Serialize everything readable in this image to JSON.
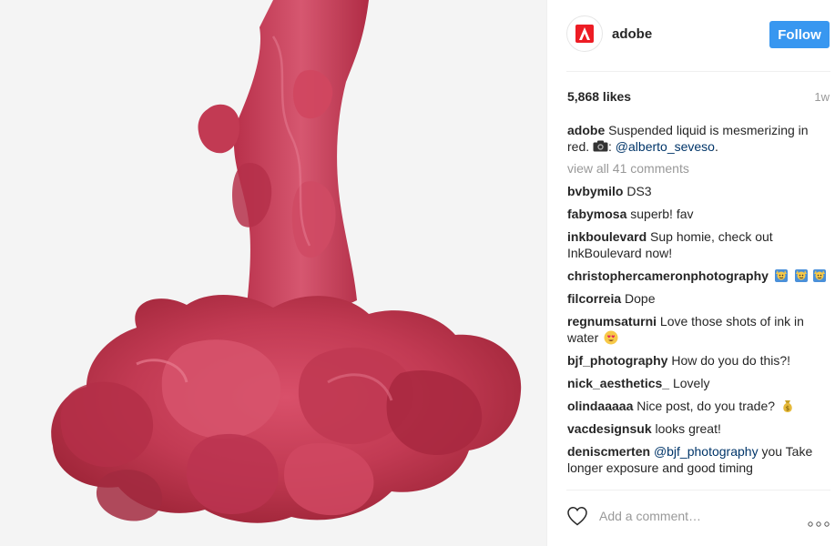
{
  "post": {
    "username": "adobe",
    "follow_label": "Follow",
    "likes": "5,868 likes",
    "time_ago": "1w",
    "caption": {
      "username": "adobe",
      "text": "Suspended liquid is mesmerizing in red. ",
      "separator": ": ",
      "mention": "@alberto_seveso",
      "end": "."
    },
    "view_all": "view all 41 comments",
    "comments": [
      {
        "user": "bvbymilo",
        "text": "DS3"
      },
      {
        "user": "fabymosa",
        "text": "superb! fav"
      },
      {
        "user": "inkboulevard",
        "text": "Sup homie, check out InkBoulevard now!"
      },
      {
        "user": "christophercameronphotography",
        "text": ""
      },
      {
        "user": "filcorreia",
        "text": "Dope"
      },
      {
        "user": "regnumsaturni",
        "text": "Love those shots of ink in water"
      },
      {
        "user": "bjf_photography",
        "text": "How do you do this?!"
      },
      {
        "user": "nick_aesthetics_",
        "text": "Lovely"
      },
      {
        "user": "olindaaaaa",
        "text": "Nice post, do you trade?"
      },
      {
        "user": "vacdesignsuk",
        "text": "looks great!"
      },
      {
        "user": "deniscmerten",
        "mention": "@bjf_photography",
        "text": "you Take longer exposure and good timing"
      }
    ],
    "add_comment_placeholder": "Add a comment…"
  },
  "icons": {
    "logo": "adobe-logo-icon",
    "camera": "camera-emoji-icon",
    "heart": "heart-icon",
    "more": "more-options-icon"
  },
  "colors": {
    "accent": "#3897f0",
    "ink": "#c23a53",
    "mention": "#003569",
    "muted": "#999999"
  }
}
